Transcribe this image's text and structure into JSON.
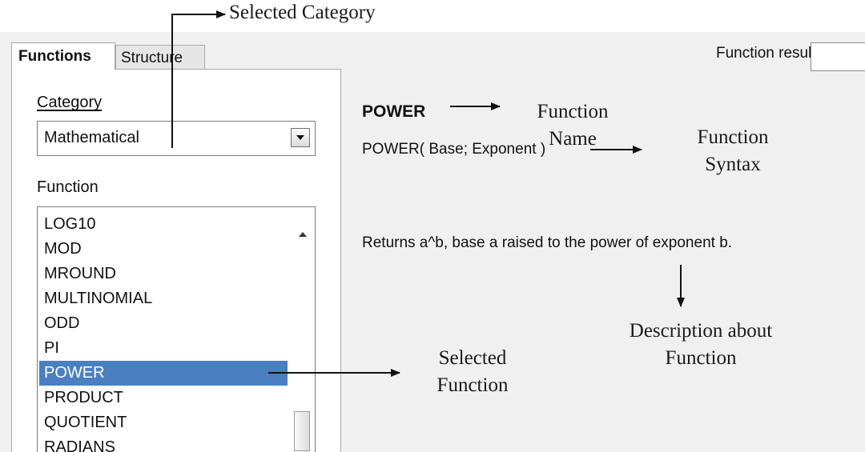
{
  "tabs": [
    {
      "label": "Functions",
      "active": true
    },
    {
      "label": "Structure",
      "active": false
    }
  ],
  "category": {
    "label": "Category",
    "value": "Mathematical"
  },
  "function": {
    "label": "Function",
    "items": [
      "LOG10",
      "MOD",
      "MROUND",
      "MULTINOMIAL",
      "ODD",
      "PI",
      "POWER",
      "PRODUCT",
      "QUOTIENT",
      "RADIANS"
    ],
    "selected": "POWER"
  },
  "result": {
    "label": "Function result",
    "value": ""
  },
  "details": {
    "name": "POWER",
    "syntax": "POWER( Base; Exponent )",
    "description": "Returns a^b, base a raised to the power of exponent b."
  },
  "annotations": {
    "selected_category": "Selected Category",
    "function_name_1": "Function",
    "function_name_2": "Name",
    "function_syntax_1": "Function",
    "function_syntax_2": "Syntax",
    "description_1": "Description about",
    "description_2": "Function",
    "selected_function_1": "Selected",
    "selected_function_2": "Function"
  },
  "colors": {
    "selection": "#4a7fc1",
    "dialog_bg": "#f0f0f0"
  }
}
